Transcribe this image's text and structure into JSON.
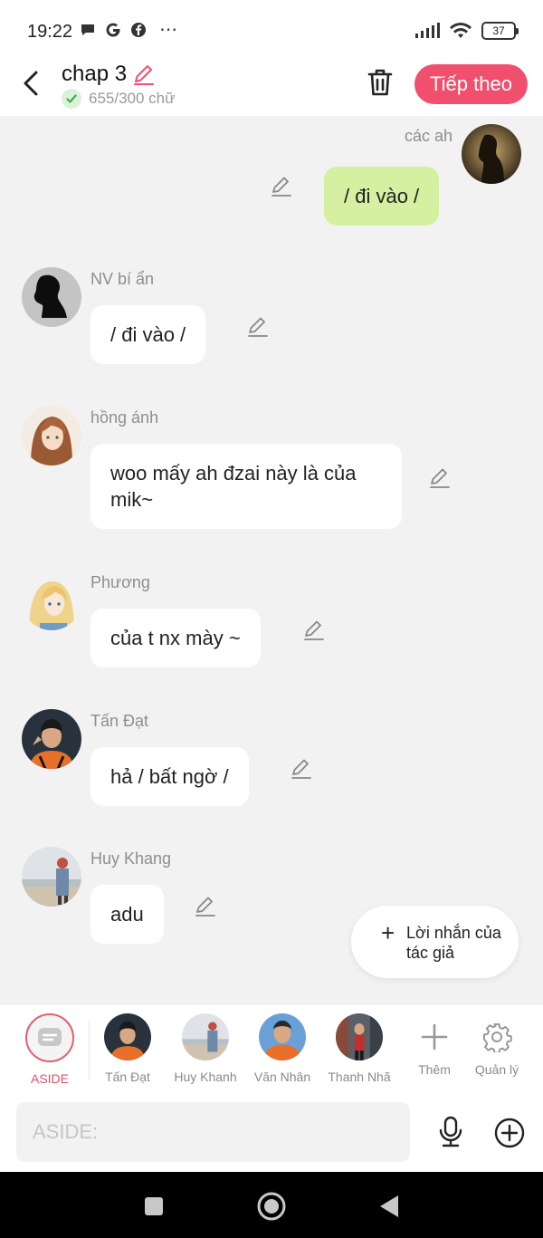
{
  "status_bar": {
    "time": "19:22",
    "battery": "37"
  },
  "header": {
    "title": "chap 3",
    "word_count": "655/300 chữ",
    "next_label": "Tiếp theo",
    "accent_color": "#f0506e"
  },
  "messages": [
    {
      "name": "các ah",
      "text": "/ đi vào /",
      "mine": true
    },
    {
      "name": "NV bí ẩn",
      "text": "/ đi vào /"
    },
    {
      "name": "hồng ánh",
      "text": "woo mấy ah đzai này là của mik~"
    },
    {
      "name": "Phương",
      "text": "của t nx mày ~"
    },
    {
      "name": "Tấn Đạt",
      "text": "hả / bất ngờ /"
    },
    {
      "name": "Huy Khang",
      "text": "adu"
    }
  ],
  "author_note": {
    "label": "Lời nhắn của tác giả"
  },
  "characters": {
    "aside": "ASIDE",
    "items": [
      "Tấn Đạt",
      "Huy Khanh",
      "Văn Nhân",
      "Thanh Nhã"
    ],
    "add": "Thêm",
    "manage": "Quản lý"
  },
  "input": {
    "placeholder": "ASIDE:"
  }
}
